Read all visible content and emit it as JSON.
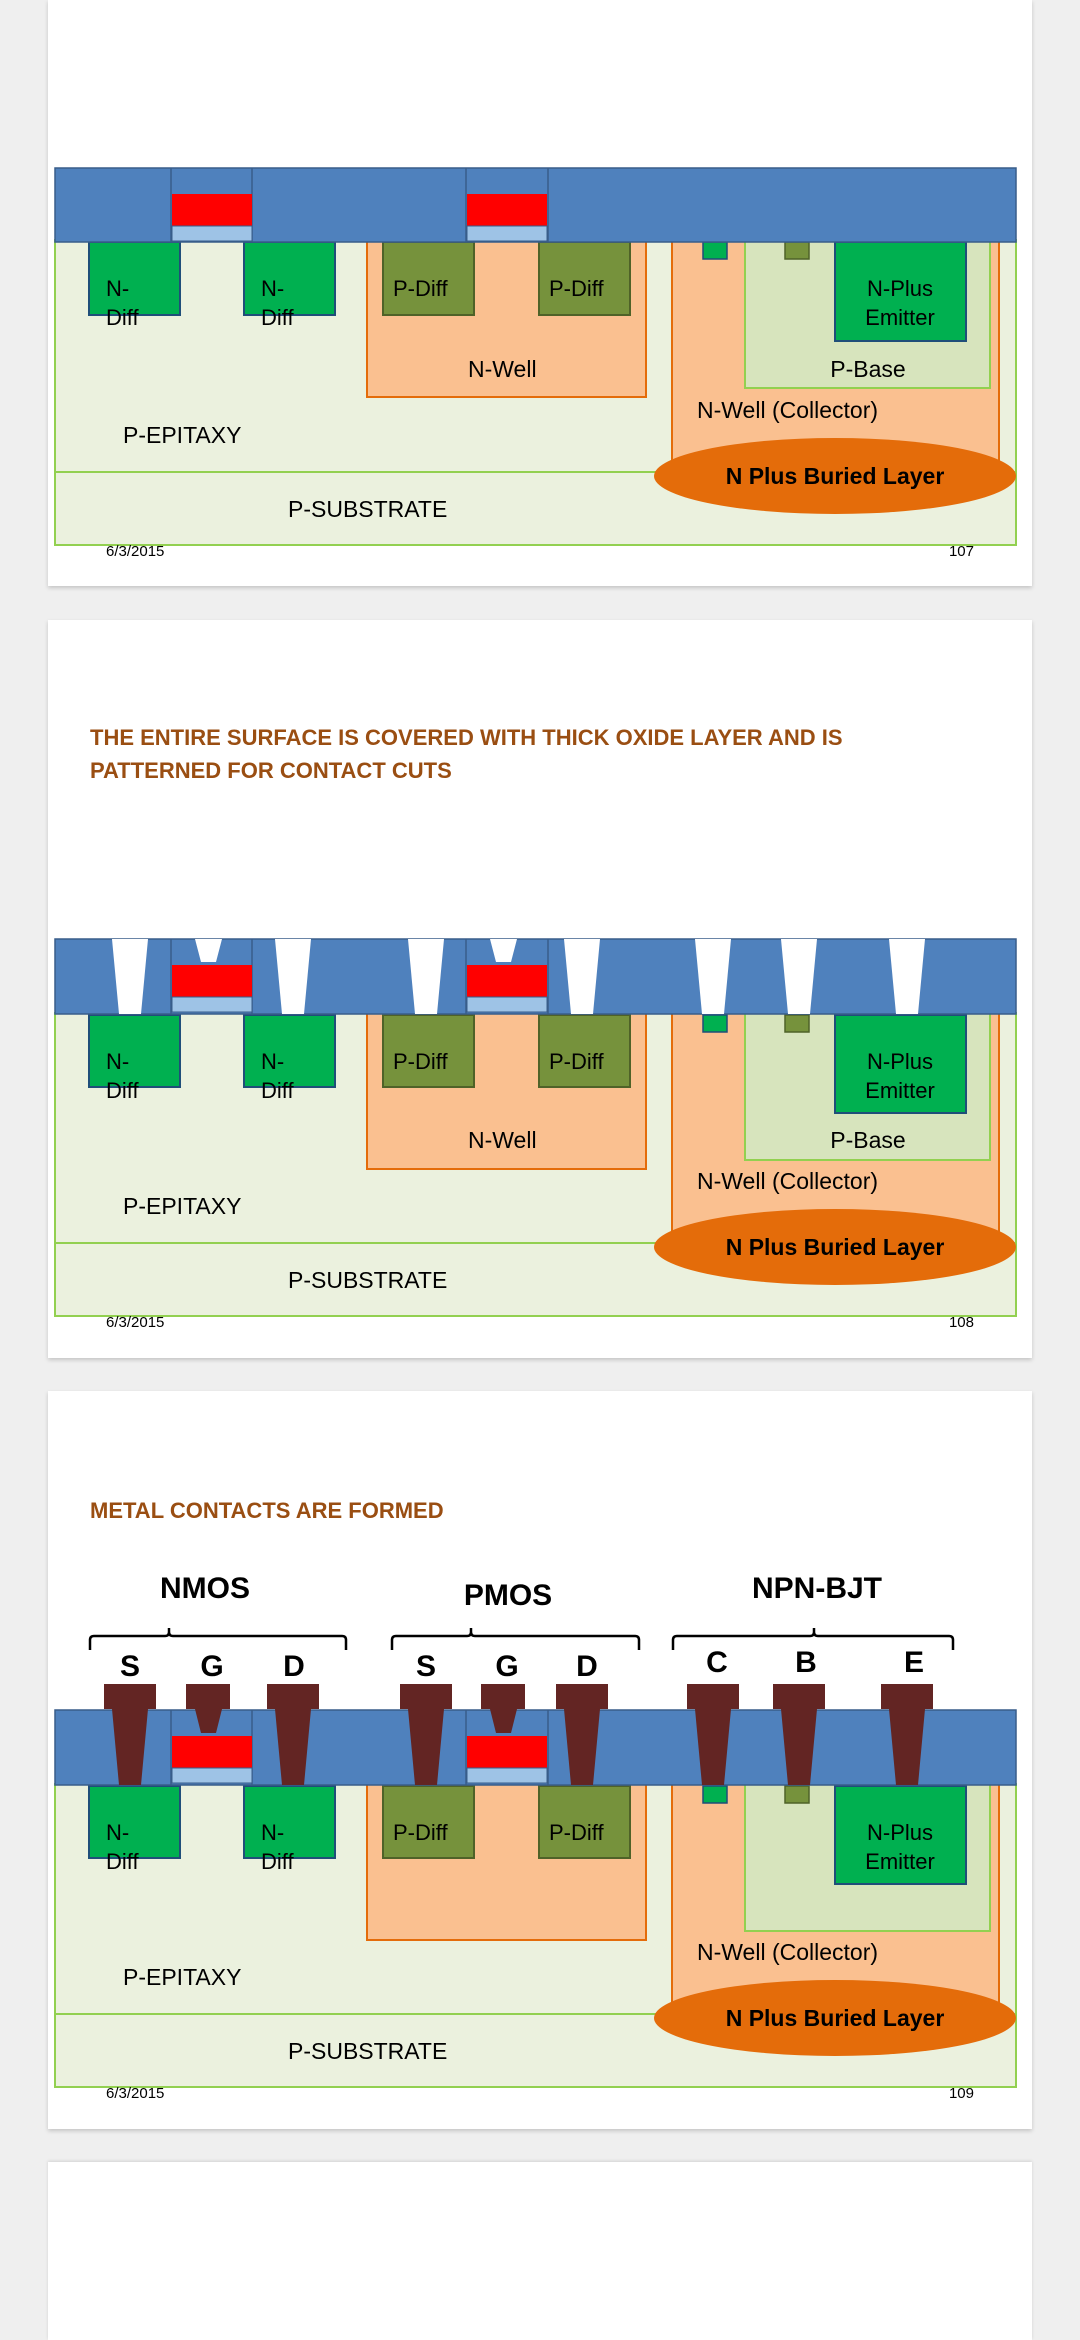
{
  "labels": {
    "n_diff_1": "N-",
    "n_diff_2": "Diff",
    "p_diff": "P-Diff",
    "n_well": "N-Well",
    "n_plus_1": "N-Plus",
    "n_plus_2": "Emitter",
    "p_base": "P-Base",
    "n_well_collector": "N-Well (Collector)",
    "p_epitaxy": "P-EPITAXY",
    "p_substrate": "P-SUBSTRATE",
    "buried_layer": "N Plus Buried Layer"
  },
  "slides": [
    {
      "title": "",
      "date": "6/3/2015",
      "number": "107"
    },
    {
      "title": "THE ENTIRE SURFACE IS COVERED WITH THICK OXIDE LAYER AND IS PATTERNED FOR CONTACT CUTS",
      "date": "6/3/2015",
      "number": "108"
    },
    {
      "title": "METAL CONTACTS ARE FORMED",
      "date": "6/3/2015",
      "number": "109"
    },
    {
      "title": ""
    }
  ],
  "devices": {
    "nmos": "NMOS",
    "pmos": "PMOS",
    "npn": "NPN-BJT",
    "terminals": [
      "S",
      "G",
      "D",
      "S",
      "G",
      "D",
      "C",
      "B",
      "E"
    ]
  },
  "colors": {
    "oxide": "#4f81bd",
    "poly_gate": "#ff0000",
    "gate_oxide": "#9ec3e6",
    "n_diffusion": "#00b050",
    "p_diffusion": "#76923c",
    "n_well": "#fac090",
    "p_epitaxy": "#ebf1de",
    "p_base": "#d7e4bd",
    "buried_layer": "#e46c0a",
    "metal": "#632523",
    "title": "#9a4e12"
  }
}
